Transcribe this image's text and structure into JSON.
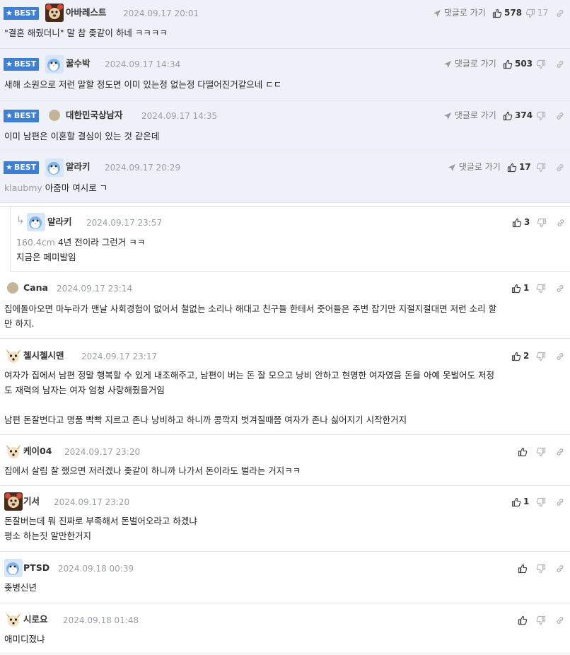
{
  "best_label": "BEST",
  "reply_go_label": "댓글로 가기",
  "comments": [
    {
      "nick": "아바레스트",
      "date": "2024.09.17 20:01",
      "up": "578",
      "down": "17",
      "text": "\"결혼 해줬더니\" 말 참 좆같이 하네 ㅋㅋㅋㅋ",
      "avatar": "bear-avatar"
    },
    {
      "nick": "꿀수박",
      "date": "2024.09.17 14:34",
      "up": "503",
      "down": "",
      "text": "새해 소원으로 저런 말할 정도면 이미 있는정 없는정 다떨어진거같으네 ㄷㄷ",
      "avatar": "bird-avatar"
    },
    {
      "nick": "대한민국상남자",
      "date": "2024.09.17 14:35",
      "up": "374",
      "down": "",
      "text": "이미 남편은 이혼할 결심이 있는 것 같은데",
      "avatar": "dot-avatar"
    },
    {
      "nick": "알라키",
      "date": "2024.09.17 20:29",
      "up": "17",
      "down": "",
      "tag": "klaubmy",
      "text": "아줌마 여시로 ㄱ",
      "avatar": "bird-avatar"
    },
    {
      "nick": "알라키",
      "date": "2024.09.17 23:57",
      "up": "3",
      "tag": "160.4cm",
      "text": "4년 전이라 그런거 ㅋㅋ",
      "text2": "지금은 페미발임",
      "avatar": "bird-avatar"
    },
    {
      "nick": "Cana",
      "date": "2024.09.17 23:14",
      "up": "1",
      "text": "집에돌아오면 마누라가 맨날 사회경험이 없어서 철없는 소리나 해대고 친구들 한테서 줏어들은 주변 잡기만 지절지절대면 저런 소리 할",
      "text2": "만 하지.",
      "avatar": "dot-avatar"
    },
    {
      "nick": "첼시첼시맨",
      "date": "2024.09.17 23:17",
      "up": "2",
      "text": "여자가 집에서 남편 정말 행복할 수 있게 내조해주고, 남편이 버는 돈 잘 모으고 낭비 안하고 현명한 여자였음 돈을 아예 못벌어도 저정",
      "text2": "도 재력의 남자는 여자 엄청 사랑해줬을거임",
      "text3": "남편 돈잘번다고 명품 빡빡 지르고 존나 낭비하고 하니까 콩깍지 벗겨질때쯤 여자가 존나 싫어지기 시작한거지",
      "avatar": "dog-avatar"
    },
    {
      "nick": "케이04",
      "date": "2024.09.17 23:20",
      "up": "",
      "text": "집에서 살림 잘 했으면 저러겠나 좆같이 하니까 나가서 돈이라도 벌라는 거지ㅋㅋ",
      "avatar": "dog-avatar"
    },
    {
      "nick": "기서",
      "date": "2024.09.17 23:20",
      "up": "1",
      "text": "돈잘버는데 뭐 진짜로 부족해서 돈벌어오라고 하겠냐",
      "text2": "평소 하는짓 알만한거지",
      "avatar": "bear-avatar"
    },
    {
      "nick": "PTSD",
      "date": "2024.09.18 00:39",
      "up": "",
      "text": "좆병신년",
      "avatar": "bird-avatar"
    },
    {
      "nick": "시로요",
      "date": "2024.09.18 01:48",
      "up": "",
      "text": "애미디졌냐",
      "avatar": "dog-avatar"
    }
  ]
}
